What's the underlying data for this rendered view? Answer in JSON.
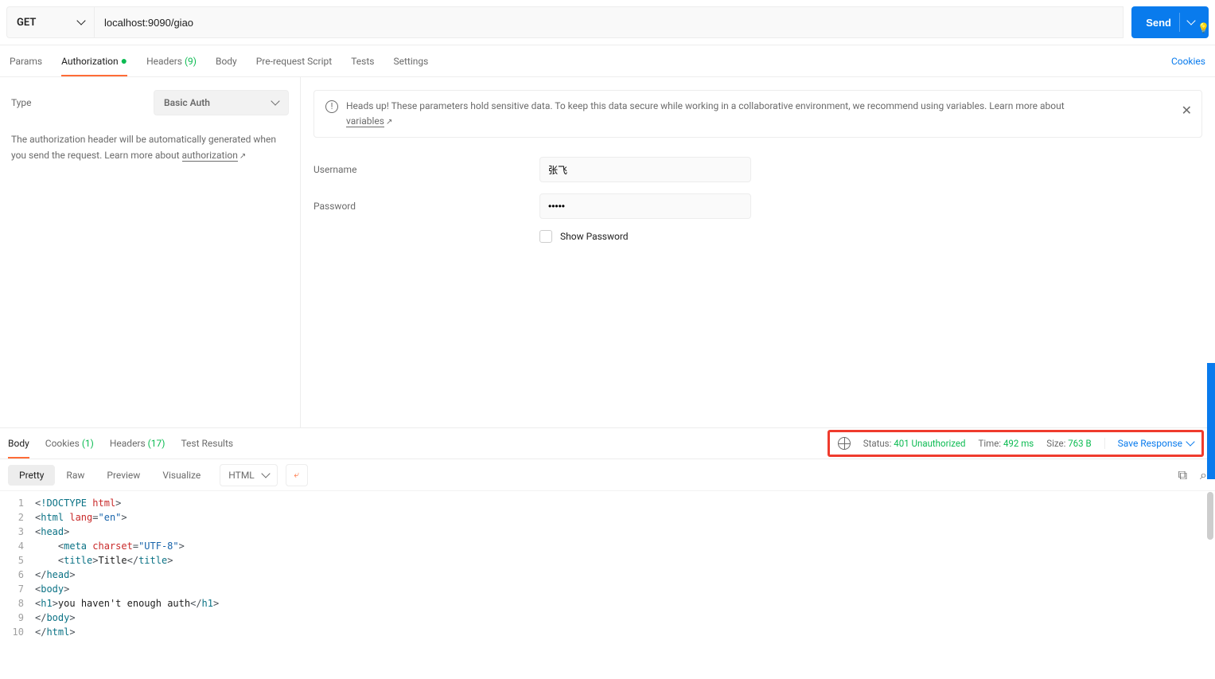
{
  "request": {
    "method": "GET",
    "url": "localhost:9090/giao",
    "send_label": "Send"
  },
  "req_tabs": {
    "params": "Params",
    "authorization": "Authorization",
    "headers": "Headers",
    "headers_count": "(9)",
    "body": "Body",
    "prerequest": "Pre-request Script",
    "tests": "Tests",
    "settings": "Settings",
    "cookies": "Cookies"
  },
  "auth": {
    "type_label": "Type",
    "type_value": "Basic Auth",
    "help_text": "The authorization header will be automatically generated when you send the request. Learn more about ",
    "help_link": "authorization",
    "banner_text": "Heads up! These parameters hold sensitive data. To keep this data secure while working in a collaborative environment, we recommend using variables. Learn more about ",
    "banner_link": "variables",
    "username_label": "Username",
    "username_value": "张飞",
    "password_label": "Password",
    "password_value": "•••••",
    "show_password": "Show Password"
  },
  "resp_tabs": {
    "body": "Body",
    "cookies": "Cookies",
    "cookies_count": "(1)",
    "headers": "Headers",
    "headers_count": "(17)",
    "test_results": "Test Results"
  },
  "status": {
    "status_label": "Status:",
    "status_value": "401 Unauthorized",
    "time_label": "Time:",
    "time_value": "492 ms",
    "size_label": "Size:",
    "size_value": "763 B",
    "save_response": "Save Response"
  },
  "view_tabs": {
    "pretty": "Pretty",
    "raw": "Raw",
    "preview": "Preview",
    "visualize": "Visualize",
    "lang": "HTML"
  },
  "code": {
    "l1": {
      "a": "<",
      "b": "!DOCTYPE ",
      "c": "html",
      "d": ">"
    },
    "l2": {
      "a": "<",
      "b": "html ",
      "c": "lang",
      "d": "=",
      "e": "\"en\"",
      "f": ">"
    },
    "l3": {
      "a": "<",
      "b": "head",
      "c": ">"
    },
    "l4": {
      "a": "    <",
      "b": "meta ",
      "c": "charset",
      "d": "=",
      "e": "\"UTF-8\"",
      "f": ">"
    },
    "l5": {
      "a": "    <",
      "b": "title",
      "c": ">",
      "d": "Title",
      "e": "</",
      "f": "title",
      "g": ">"
    },
    "l6": {
      "a": "</",
      "b": "head",
      "c": ">"
    },
    "l7": {
      "a": "<",
      "b": "body",
      "c": ">"
    },
    "l8": {
      "a": "<",
      "b": "h1",
      "c": ">",
      "d": "you haven't enough auth",
      "e": "</",
      "f": "h1",
      "g": ">"
    },
    "l9": {
      "a": "</",
      "b": "body",
      "c": ">"
    },
    "l10": {
      "a": "</",
      "b": "html",
      "c": ">"
    }
  }
}
